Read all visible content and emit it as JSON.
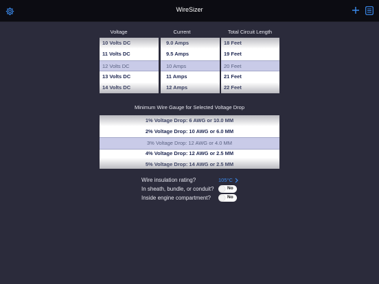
{
  "app": {
    "title": "WireSizer"
  },
  "icons": {
    "settings": "gear-icon",
    "add": "plus-icon",
    "list": "list-icon",
    "chevron": "chevron-right-icon"
  },
  "colors": {
    "background": "#2b2b3b",
    "navbar": "#0c0c12",
    "accent": "#3b8cf0",
    "selected_row": "#c9cbe8"
  },
  "pickers": {
    "voltage": {
      "header": "Voltage",
      "rows": [
        "10 Volts DC",
        "11 Volts DC",
        "12 Volts DC",
        "13 Volts DC",
        "14 Volts DC"
      ],
      "selected": "12 Volts DC"
    },
    "current": {
      "header": "Current",
      "rows": [
        "9.0 Amps",
        "9.5 Amps",
        "10 Amps",
        "11 Amps",
        "12 Amps"
      ],
      "selected": "10 Amps"
    },
    "length": {
      "header": "Total Circuit Length",
      "rows": [
        "18 Feet",
        "19 Feet",
        "20 Feet",
        "21 Feet",
        "22 Feet"
      ],
      "selected": "20 Feet"
    }
  },
  "results": {
    "title": "Minimum Wire Gauge for Selected Voltage Drop",
    "rows": [
      "1% Voltage Drop: 6 AWG or 10.0 MM",
      "2% Voltage Drop: 10 AWG or 6.0 MM",
      "3% Voltage Drop: 12 AWG or 4.0 MM",
      "4% Voltage Drop: 12 AWG or 2.5 MM",
      "5% Voltage Drop: 14 AWG or 2.5 MM"
    ],
    "selected": "3% Voltage Drop: 12 AWG or 4.0 MM"
  },
  "options": {
    "insulation": {
      "label": "Wire insulation rating?",
      "value": "105°C"
    },
    "sheath": {
      "label": "In sheath, bundle, or conduit?",
      "value": "No"
    },
    "engine": {
      "label": "Inside engine compartment?",
      "value": "No"
    }
  }
}
